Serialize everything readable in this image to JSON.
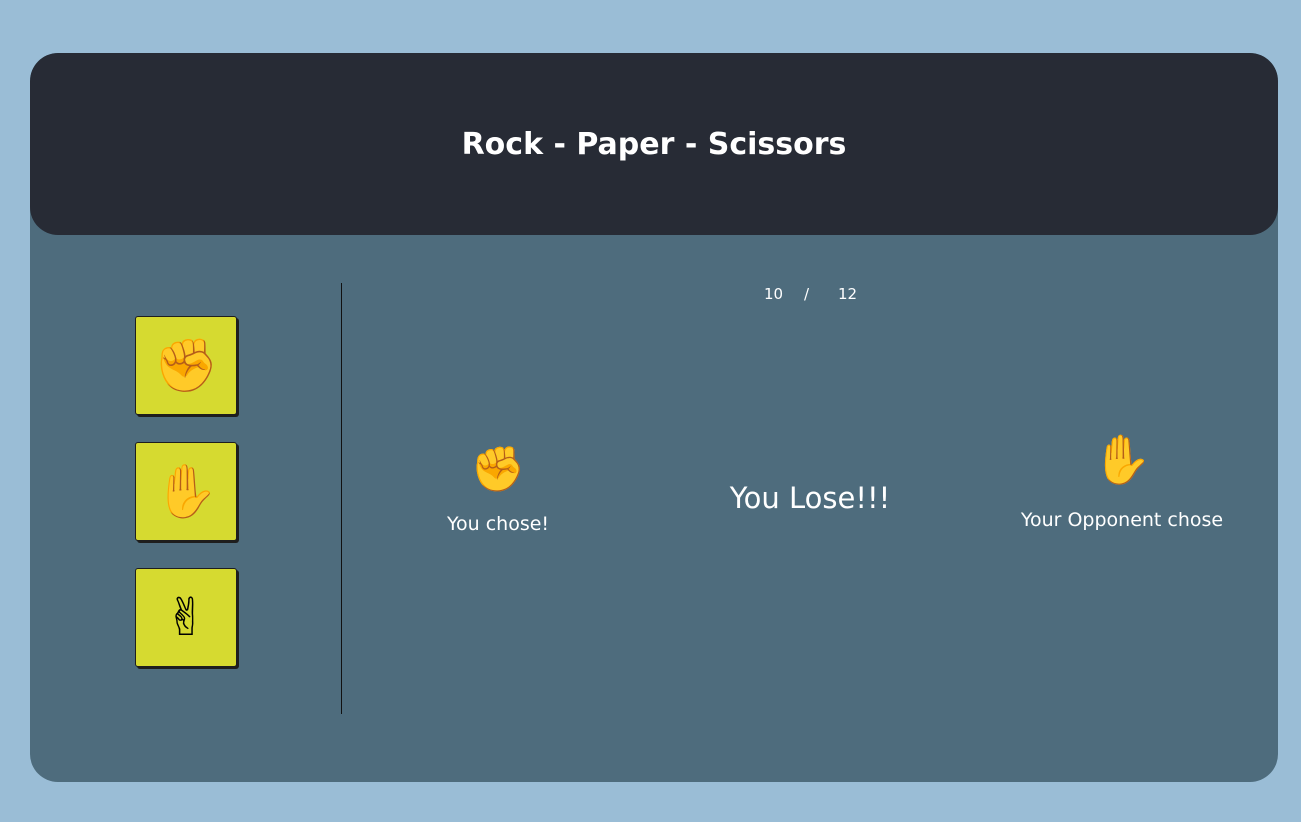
{
  "header": {
    "title": "Rock - Paper - Scissors"
  },
  "choices": [
    {
      "name": "rock",
      "emoji": "✊"
    },
    {
      "name": "paper",
      "emoji": "✋"
    },
    {
      "name": "scissors",
      "emoji": "✌"
    }
  ],
  "score": {
    "player": "10",
    "separator": "/",
    "opponent": "12"
  },
  "player": {
    "emoji": "✊",
    "label": "You chose!"
  },
  "result": {
    "text": "You Lose!!!"
  },
  "opponent": {
    "emoji": "✋",
    "label": "Your Opponent chose"
  },
  "colors": {
    "page_background": "#9abdd6",
    "card_background": "#4e6c7d",
    "header_background": "#272b35",
    "choice_button": "#d6da30"
  }
}
